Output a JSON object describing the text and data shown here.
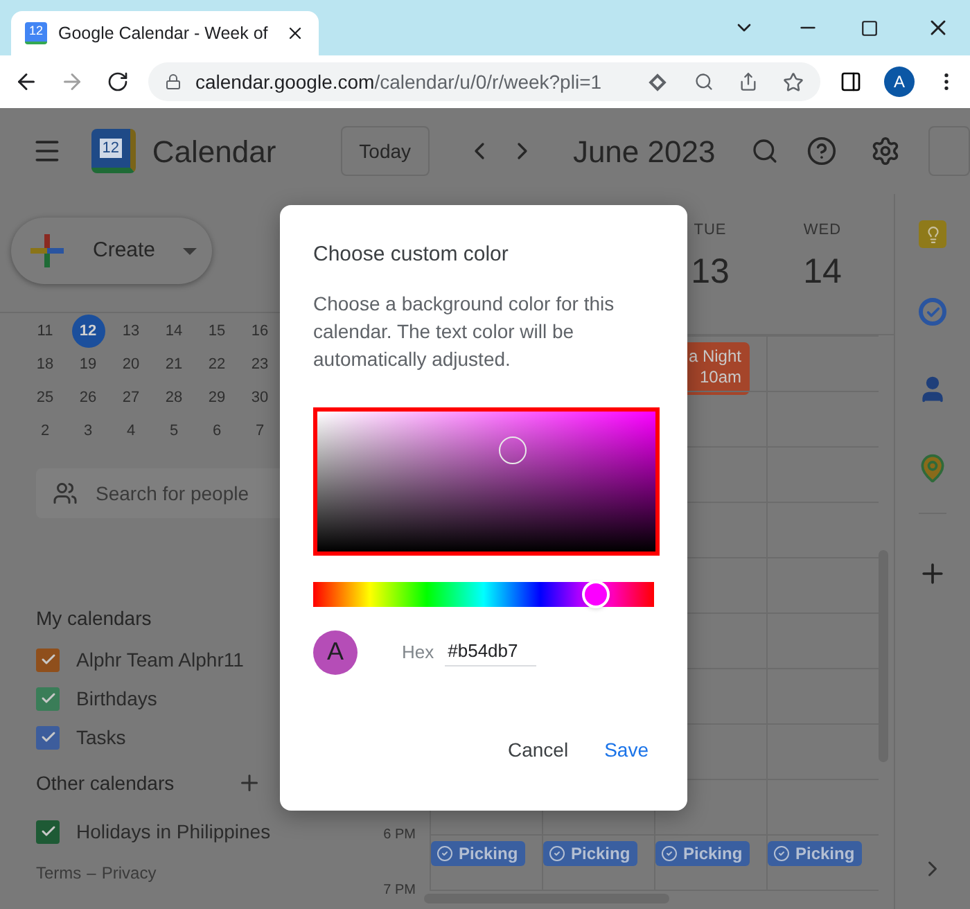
{
  "browser": {
    "favicon_text": "12",
    "tab_title": "Google Calendar - Week of",
    "url_domain": "calendar.google.com",
    "url_path": "/calendar/u/0/r/week?pli=1",
    "profile_initial": "A"
  },
  "header": {
    "app_name": "Calendar",
    "logo_text": "12",
    "today_button": "Today",
    "period": "June 2023"
  },
  "sidebar": {
    "create_button": "Create",
    "mini_calendar": [
      [
        {
          "day": "11",
          "selected": false
        },
        {
          "day": "12",
          "selected": true
        },
        {
          "day": "13",
          "selected": false
        },
        {
          "day": "14",
          "selected": false
        },
        {
          "day": "15",
          "selected": false
        },
        {
          "day": "16",
          "selected": false
        }
      ],
      [
        {
          "day": "18",
          "selected": false
        },
        {
          "day": "19",
          "selected": false
        },
        {
          "day": "20",
          "selected": false
        },
        {
          "day": "21",
          "selected": false
        },
        {
          "day": "22",
          "selected": false
        },
        {
          "day": "23",
          "selected": false
        }
      ],
      [
        {
          "day": "25",
          "selected": false
        },
        {
          "day": "26",
          "selected": false
        },
        {
          "day": "27",
          "selected": false
        },
        {
          "day": "28",
          "selected": false
        },
        {
          "day": "29",
          "selected": false
        },
        {
          "day": "30",
          "selected": false
        }
      ],
      [
        {
          "day": "2",
          "selected": false
        },
        {
          "day": "3",
          "selected": false
        },
        {
          "day": "4",
          "selected": false
        },
        {
          "day": "5",
          "selected": false
        },
        {
          "day": "6",
          "selected": false
        },
        {
          "day": "7",
          "selected": false
        }
      ]
    ],
    "search_placeholder": "Search for people",
    "my_calendars": {
      "title": "My calendars",
      "items": [
        {
          "label": "Alphr Team Alphr11",
          "checked": true,
          "color": "#8f4f1c"
        },
        {
          "label": "Birthdays",
          "checked": true,
          "color": "#3a7d58"
        },
        {
          "label": "Tasks",
          "checked": true,
          "color": "#3d5d9c"
        }
      ]
    },
    "other_calendars": {
      "title": "Other calendars",
      "items": [
        {
          "label": "Holidays in Philippines",
          "checked": true,
          "color": "#1e5a35"
        }
      ]
    },
    "footer": [
      "Terms",
      "–",
      "Privacy"
    ]
  },
  "week": {
    "days": [
      {
        "weekday": "TUE",
        "date": "13"
      },
      {
        "weekday": "WED",
        "date": "14"
      }
    ],
    "event": {
      "title": "a Night",
      "time": "10am"
    },
    "rows": [
      {
        "time": "6 PM",
        "chips": [
          {
            "label": "Picking"
          },
          {
            "label": "Picking"
          },
          {
            "label": "Picking"
          },
          {
            "label": "Picking"
          }
        ]
      },
      {
        "time": "7 PM",
        "chips": []
      }
    ]
  },
  "dialog": {
    "title": "Choose custom color",
    "description": "Choose a background color for this calendar. The text color will be automatically adjusted.",
    "hue": {
      "level": 0.83
    },
    "avatar_initial": "A",
    "hex_label": "Hex",
    "hex_value": "#b54db7",
    "buttons": [
      "Cancel",
      "Save"
    ]
  }
}
